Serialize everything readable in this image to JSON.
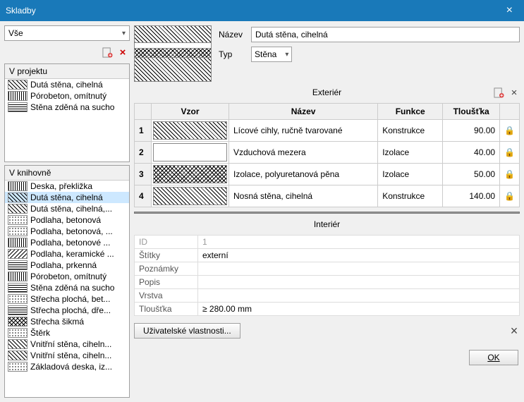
{
  "window": {
    "title": "Skladby"
  },
  "filter": {
    "value": "Vše"
  },
  "form": {
    "name_label": "Název",
    "name_value": "Dutá stěna, cihelná",
    "type_label": "Typ",
    "type_value": "Stěna"
  },
  "sections": {
    "exterior": "Exteriér",
    "interior": "Interiér"
  },
  "project": {
    "title": "V projektu",
    "items": [
      {
        "label": "Dutá stěna, cihelná",
        "hatch": "hatch-diag"
      },
      {
        "label": "Pórobeton, omítnutý",
        "hatch": "hatch-vert"
      },
      {
        "label": "Stěna zděná na sucho",
        "hatch": "hatch-horiz"
      }
    ]
  },
  "library": {
    "title": "V knihovně",
    "items": [
      {
        "label": "Deska, překližka",
        "hatch": "hatch-vert"
      },
      {
        "label": "Dutá stěna, cihelná",
        "hatch": "hatch-diag",
        "selected": true
      },
      {
        "label": "Dutá stěna, cihelná,...",
        "hatch": "hatch-diag"
      },
      {
        "label": "Podlaha, betonová",
        "hatch": "hatch-dots"
      },
      {
        "label": "Podlaha, betonová, ...",
        "hatch": "hatch-dots"
      },
      {
        "label": "Podlaha, betonové ...",
        "hatch": "hatch-vert"
      },
      {
        "label": "Podlaha, keramické ...",
        "hatch": "hatch-diag2"
      },
      {
        "label": "Podlaha, prkenná",
        "hatch": "hatch-horiz"
      },
      {
        "label": "Pórobeton, omítnutý",
        "hatch": "hatch-vert"
      },
      {
        "label": "Stěna zděná na sucho",
        "hatch": "hatch-horiz"
      },
      {
        "label": "Střecha plochá, bet...",
        "hatch": "hatch-dots"
      },
      {
        "label": "Střecha plochá, dře...",
        "hatch": "hatch-horiz"
      },
      {
        "label": "Střecha šikmá",
        "hatch": "hatch-cross"
      },
      {
        "label": "Štěrk",
        "hatch": "hatch-dots"
      },
      {
        "label": "Vnitřní stěna, ciheln...",
        "hatch": "hatch-diag"
      },
      {
        "label": "Vnitřní stěna, ciheln...",
        "hatch": "hatch-diag"
      },
      {
        "label": "Základová deska, iz...",
        "hatch": "hatch-dots"
      }
    ]
  },
  "layers": {
    "headers": {
      "pattern": "Vzor",
      "name": "Název",
      "function": "Funkce",
      "thickness": "Tloušťka"
    },
    "rows": [
      {
        "n": "1",
        "hatch": "hatch-diag",
        "name": "Lícové cihly, ručně tvarované",
        "func": "Konstrukce",
        "thick": "90.00",
        "lock": "plain"
      },
      {
        "n": "2",
        "hatch": "hatch-blank",
        "name": "Vzduchová mezera",
        "func": "Izolace",
        "thick": "40.00",
        "lock": "gold"
      },
      {
        "n": "3",
        "hatch": "hatch-cross",
        "name": "Izolace, polyuretanová pěna",
        "func": "Izolace",
        "thick": "50.00",
        "lock": "plain"
      },
      {
        "n": "4",
        "hatch": "hatch-diag",
        "name": "Nosná stěna, cihelná",
        "func": "Konstrukce",
        "thick": "140.00",
        "lock": "plain"
      }
    ]
  },
  "props": {
    "rows": [
      {
        "k": "ID",
        "v": "1"
      },
      {
        "k": "Štítky",
        "v": "externí"
      },
      {
        "k": "Poznámky",
        "v": ""
      },
      {
        "k": "Popis",
        "v": ""
      },
      {
        "k": "Vrstva",
        "v": ""
      },
      {
        "k": "Tloušťka",
        "v": "≥ 280.00 mm"
      }
    ]
  },
  "buttons": {
    "user_props": "Uživatelské vlastnosti...",
    "ok": "OK"
  }
}
